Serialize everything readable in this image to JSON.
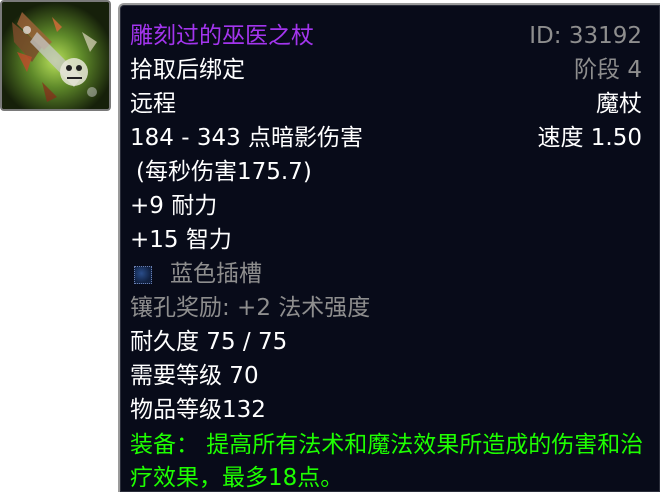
{
  "item": {
    "name": "雕刻过的巫医之杖",
    "id_text": "ID: 33192",
    "binding": "拾取后绑定",
    "phase": "阶段 4",
    "slot": "远程",
    "type": "魔杖",
    "damage": "184 - 343 点暗影伤害",
    "speed": "速度 1.50",
    "dps": "(每秒伤害175.7)",
    "stat_stamina": "+9 耐力",
    "stat_intellect": "+15 智力",
    "socket": "蓝色插槽",
    "socket_bonus": "镶孔奖励: +2 法术强度",
    "durability": "耐久度 75 / 75",
    "required_level": "需要等级 70",
    "item_level": "物品等级132",
    "equip_label": "装备：",
    "equip_text": " 提高所有法术和魔法效果所造成的伤害和治疗效果，最多18点。"
  },
  "icon": {
    "name": "wand-item-icon"
  },
  "colors": {
    "epic_name": "#a335ee",
    "grey": "#8e8e8e",
    "equip_green": "#1eff00",
    "tooltip_bg": "#080b19",
    "socket_blue": "#2a4d8a"
  }
}
